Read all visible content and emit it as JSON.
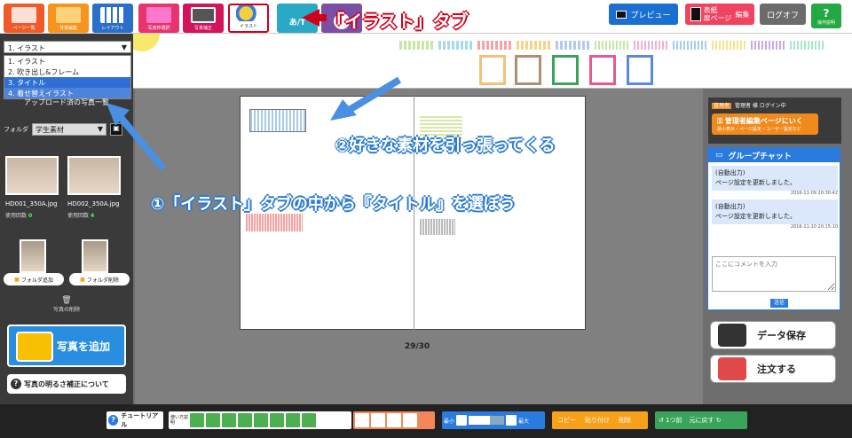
{
  "toolbar": {
    "tabs": [
      {
        "label": "ページ一覧",
        "color": "#f05a28"
      },
      {
        "label": "背景編集",
        "color": "#f7941d"
      },
      {
        "label": "レイアウト",
        "color": "#2a6fc9"
      },
      {
        "label": "写真枠選択",
        "color": "#e8336d"
      },
      {
        "label": "写真補正",
        "color": "#d4145a"
      },
      {
        "label": "イラスト",
        "color": "#ffffff"
      },
      {
        "label": "",
        "color": "#2aa9c7"
      },
      {
        "label": "",
        "color": "#7b4fa6"
      }
    ],
    "preview": "プレビュー",
    "cover_line1": "表紙",
    "cover_line2": "扉ページ",
    "cover_edit": "編集",
    "logoff": "ログオフ",
    "help": "操作説明"
  },
  "sidebar": {
    "category_selected": "1. イラスト",
    "category_options": [
      "1. イラスト",
      "2. 吹き出し&フレーム",
      "3. タイトル",
      "4. 着せ替えイラスト"
    ],
    "upload_title": "アップロード済の写真一覧",
    "folder_label": "フォルダ",
    "folder_selected": "学生素材",
    "photos": [
      {
        "name": "HD001_350A.jpg",
        "use_label": "使用回数",
        "count": "0"
      },
      {
        "name": "HD002_350A.jpg",
        "use_label": "使用回数",
        "count": "4"
      }
    ],
    "add_folder": "フォルダ追加",
    "delete_folder": "フォルダ削除",
    "delete_photo": "写真の削除",
    "add_photo": "写真を追加",
    "brightness": "写真の明るさ補正について"
  },
  "canvas": {
    "page_number": "29/30"
  },
  "right": {
    "admin_badge": "管理者",
    "admin_text": "管理者 様 ログイン中",
    "admin_button": "管理者編集ページにいく",
    "admin_button_sub": "最小表示・ページ設定・ユーザー設定など",
    "chat_title": "グループチャット",
    "messages": [
      {
        "author": "(自動出力)",
        "text": "ページ設定を更新しました。",
        "time": "2016-11-09 20:30:42"
      },
      {
        "author": "(自動出力)",
        "text": "ページ設定を更新しました。",
        "time": "2016-11-10 20:15:10"
      }
    ],
    "comment_placeholder": "ここにコメントを入力",
    "send": "送信",
    "save_data": "データ保存",
    "order": "注文する"
  },
  "bottombar": {
    "tutorial": "チュートリアル",
    "align_label": "使い方説明",
    "zoom_min": "最小",
    "zoom_max": "最大",
    "copy": "コピー",
    "paste": "貼り付け",
    "delete": "削除",
    "undo": "1つ前",
    "redo": "元に戻す"
  },
  "annotations": {
    "tab_callout": "「イラスト」タブ",
    "step2": "②好きな素材を引っ張ってくる",
    "step1": "①「イラスト」タブの中から『タイトル』を選ぼう"
  },
  "colors": {
    "accent": "#2a7be0",
    "callout_red": "#d0001c",
    "callout_blue": "#2a7bd0"
  }
}
